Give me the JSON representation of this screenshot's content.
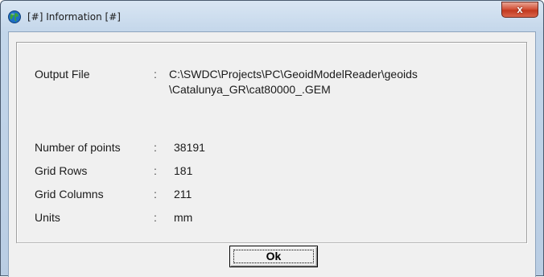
{
  "window": {
    "title": "[#] Information [#]",
    "close_label": "x",
    "app_icon": "globe-icon"
  },
  "info": {
    "output_file_label": "Output File",
    "output_file_value_line1": "C:\\SWDC\\Projects\\PC\\GeoidModelReader\\geoids",
    "output_file_value_line2": "\\Catalunya_GR\\cat80000_.GEM",
    "separator": ":",
    "rows": [
      {
        "label": "Number of points",
        "value": "38191"
      },
      {
        "label": "Grid Rows",
        "value": "181"
      },
      {
        "label": "Grid Columns",
        "value": "211"
      },
      {
        "label": "Units",
        "value": "mm"
      }
    ]
  },
  "buttons": {
    "ok_label": "Ok"
  },
  "colors": {
    "titlebar": "#c3d6ea",
    "client": "#f0f0f0",
    "close_button": "#c2391f"
  }
}
